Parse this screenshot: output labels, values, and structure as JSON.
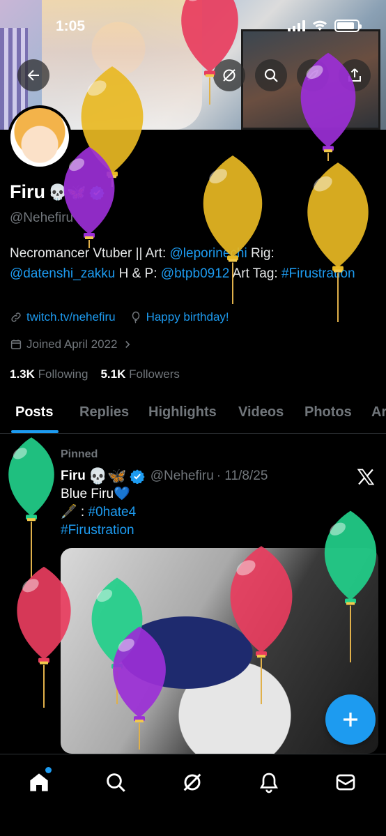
{
  "status_bar": {
    "time": "1:05",
    "battery_level": 0.85
  },
  "header": {
    "back_icon": "back-arrow-icon",
    "grok_icon": "grok-icon",
    "search_icon": "search-icon",
    "share_icon": "share-icon"
  },
  "profile": {
    "display_name": "Firu",
    "name_emojis": "💀🦋",
    "handle": "@Nehefiru",
    "bio_parts": {
      "p1": "Necromancer Vtuber || Art: ",
      "l1": "@leporinechi",
      "p2": " Rig: ",
      "l2": "@datenshi_zakku",
      "p3": " H & P: ",
      "l3": "@btpb0912",
      "p4": " Art Tag: ",
      "l4": "#Firustration"
    },
    "website": "twitch.tv/nehefiru",
    "birthday": "Happy birthday!",
    "joined": "Joined April 2022",
    "following_count": "1.3K",
    "following_label": "Following",
    "followers_count": "5.1K",
    "followers_label": "Followers"
  },
  "tabs": [
    "Posts",
    "Replies",
    "Highlights",
    "Videos",
    "Photos",
    "Ar"
  ],
  "post": {
    "pinned_label": "Pinned",
    "author_name": "Firu",
    "author_emojis": "💀🦋",
    "author_handle": "@Nehefiru",
    "date": "· 11/8/25",
    "line1": "Blue Firu💙",
    "line2_prefix": "🖋️ : ",
    "line2_tag": "#0hate4",
    "line3_tag": "#Firustration"
  },
  "colors": {
    "accent": "#1d9bf0",
    "balloon_yellow": "#e8b923",
    "balloon_purple": "#9b2fd6",
    "balloon_green": "#22cf8a",
    "balloon_red": "#e83d5e"
  }
}
